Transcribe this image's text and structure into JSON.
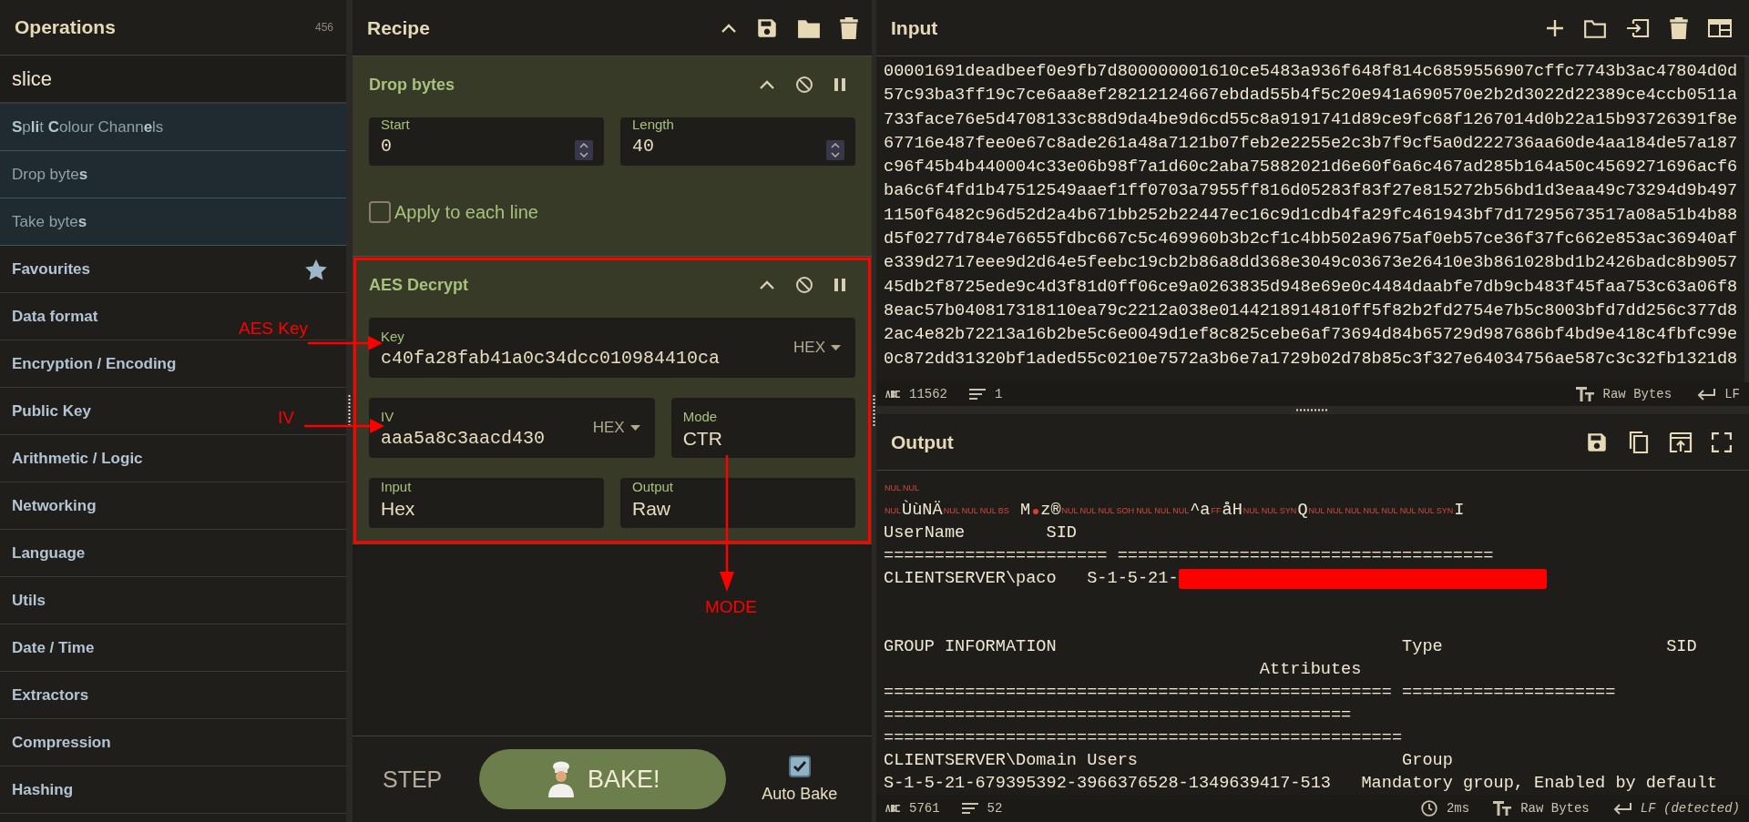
{
  "operations": {
    "title": "Operations",
    "count": "456",
    "search": {
      "value": "slice"
    },
    "results": [
      {
        "label": "**S**p**li**t **C**olour Chann**e**ls"
      },
      {
        "label": "Drop byte**s**"
      },
      {
        "label": "Take byte**s**"
      }
    ],
    "categories": [
      {
        "label": "Favourites",
        "kind": "favourites"
      },
      {
        "label": "Data format",
        "kind": "category"
      },
      {
        "label": "Encryption / Encoding",
        "kind": "category"
      },
      {
        "label": "Public Key",
        "kind": "category"
      },
      {
        "label": "Arithmetic / Logic",
        "kind": "category"
      },
      {
        "label": "Networking",
        "kind": "category"
      },
      {
        "label": "Language",
        "kind": "category"
      },
      {
        "label": "Utils",
        "kind": "category"
      },
      {
        "label": "Date / Time",
        "kind": "category"
      },
      {
        "label": "Extractors",
        "kind": "category"
      },
      {
        "label": "Compression",
        "kind": "category"
      },
      {
        "label": "Hashing",
        "kind": "category"
      }
    ]
  },
  "recipe": {
    "title": "Recipe",
    "operations": [
      {
        "kind": "drop_bytes",
        "title": "Drop bytes",
        "highlighted": false,
        "fields": [
          {
            "kind": "number",
            "label": "Start",
            "value": "0"
          },
          {
            "kind": "number",
            "label": "Length",
            "value": "40"
          }
        ],
        "checkbox": {
          "label": "Apply to each line",
          "checked": false
        }
      },
      {
        "kind": "aes_decrypt",
        "title": "AES Decrypt",
        "highlighted": true,
        "fields": [
          {
            "kind": "toggle_string",
            "label": "Key",
            "value": "c40fa28fab41a0c34dcc010984410ca",
            "format": "HEX"
          },
          {
            "kind": "toggle_string",
            "label": "IV",
            "value": "aaa5a8c3aacd430",
            "format": "HEX"
          },
          {
            "kind": "select",
            "label": "Mode",
            "value": "CTR"
          },
          {
            "kind": "select",
            "label": "Input",
            "value": "Hex"
          },
          {
            "kind": "select",
            "label": "Output",
            "value": "Raw"
          }
        ]
      }
    ],
    "step": "STEP",
    "bake": "BAKE!",
    "auto_bake": {
      "label": "Auto Bake",
      "checked": true
    }
  },
  "input": {
    "title": "Input",
    "lines": [
      "00001691deadbeef0e9fb7d800000001610ce5483a936f648f814c6859556907cffc7743b3ac47804d0d",
      "57c93ba3ff19c7ce6aa8ef28212124667ebdad55b4f5c20e941a690570e2b2d3022d22389ce4ccb0511a",
      "733face76e5d4708133c88d9da4be9d6cd55c8a9191741d89ce9fc68f1267014d0b22a15b93726391f8e",
      "67716e487fee0e67c8ade261a48a7121b07feb2e2255e2c3b7f9cf5a0d222736aa60de4aa184de57a187",
      "c96f45b4b440004c33e06b98f7a1d60c2aba75882021d6e60f6a6c467ad285b164a50c4569271696acf6",
      "ba6c6f4fd1b47512549aaef1ff0703a7955ff816d05283f83f27e815272b56bd1d3eaa49c73294d9b497",
      "1150f6482c96d52d2a4b671bb252b22447ec16c9d1cdb4fa29fc461943bf7d17295673517a08a51b4b88",
      "d5f0277d784e76655fdbc667c5c469960b3b2cf1c4bb502a9675af0eb57ce36f37fc662e853ac36940af",
      "e339d2717eee9d2d64e5feebc19cb2b86a8dd368e3049c03673e26410e3b861028bd1b2426badc8b9057",
      "45db2f8725ede9c4d3f81d0ff06ce9a0263835d948e69e0c4484daabfe7db9cb483f45faa753c63a06f8",
      "8eac57b040817318110ea79c2212a038e0144218914810ff5f82b2fd2754e7b5c8003bfd7dd256c377d8",
      "2ac4e82b72213a16b2be5c6e0049d1ef8c825cebe6af73694d84b65729d987686bf4bd9e418c4fbfc99e",
      "0c872dd31320bf1aded55c0210e7572a3b6e7a1729b02d78b85c3f327e64034756ae587c3c32fb1321d8"
    ],
    "status": {
      "length": "11562",
      "lines": "1",
      "format": "Raw Bytes",
      "eol": "LF"
    }
  },
  "output": {
    "title": "Output",
    "lines": [
      [
        {
          "kind": "ctrl",
          "text": "NUL"
        },
        {
          "kind": "ctrl",
          "text": "NUL"
        }
      ],
      [
        {
          "kind": "ctrl",
          "text": "NUL"
        },
        {
          "kind": "text",
          "text": "ÙùNÄ"
        },
        {
          "kind": "ctrl",
          "text": "NUL"
        },
        {
          "kind": "ctrl",
          "text": "NUL"
        },
        {
          "kind": "ctrl",
          "text": "NUL"
        },
        {
          "kind": "ctrl",
          "text": "BS"
        },
        {
          "kind": "text",
          "text": " M"
        },
        {
          "kind": "dot"
        },
        {
          "kind": "text",
          "text": "z®"
        },
        {
          "kind": "ctrl",
          "text": "NUL"
        },
        {
          "kind": "ctrl",
          "text": "NUL"
        },
        {
          "kind": "ctrl",
          "text": "NUL"
        },
        {
          "kind": "ctrl",
          "text": "SOH"
        },
        {
          "kind": "ctrl",
          "text": "NUL"
        },
        {
          "kind": "ctrl",
          "text": "NUL"
        },
        {
          "kind": "ctrl",
          "text": "NUL"
        },
        {
          "kind": "text",
          "text": "^a"
        },
        {
          "kind": "ctrl",
          "text": "FF"
        },
        {
          "kind": "text",
          "text": "åH"
        },
        {
          "kind": "ctrl",
          "text": "NUL"
        },
        {
          "kind": "ctrl",
          "text": "NUL"
        },
        {
          "kind": "ctrl",
          "text": "SYN"
        },
        {
          "kind": "text",
          "text": "Q"
        },
        {
          "kind": "ctrl",
          "text": "NUL"
        },
        {
          "kind": "ctrl",
          "text": "NUL"
        },
        {
          "kind": "ctrl",
          "text": "NUL"
        },
        {
          "kind": "ctrl",
          "text": "NUL"
        },
        {
          "kind": "ctrl",
          "text": "NUL"
        },
        {
          "kind": "ctrl",
          "text": "NUL"
        },
        {
          "kind": "ctrl",
          "text": "NUL"
        },
        {
          "kind": "ctrl",
          "text": "SYN"
        },
        {
          "kind": "text",
          "text": "I"
        }
      ],
      "UserName        SID",
      "====================== =====================================",
      [
        {
          "kind": "text",
          "text": "CLIENTSERVER\\paco   S-1-5-21-"
        },
        {
          "kind": "redacted"
        }
      ],
      {
        "kind": "blank"
      },
      {
        "kind": "blank"
      },
      "GROUP INFORMATION                                  Type                      SID",
      "                                     Attributes",
      "================================================== =====================",
      "==============================================",
      "===================================================",
      "CLIENTSERVER\\Domain Users                          Group",
      "S-1-5-21-679395392-3966376528-1349639417-513   Mandatory group, Enabled by default"
    ],
    "status": {
      "length": "5761",
      "lines": "52",
      "time": "2ms",
      "format": "Raw Bytes",
      "eol": "LF (detected)"
    }
  },
  "annotations": [
    {
      "text": "AES Key"
    },
    {
      "text": "IV"
    },
    {
      "text": "MODE"
    }
  ]
}
